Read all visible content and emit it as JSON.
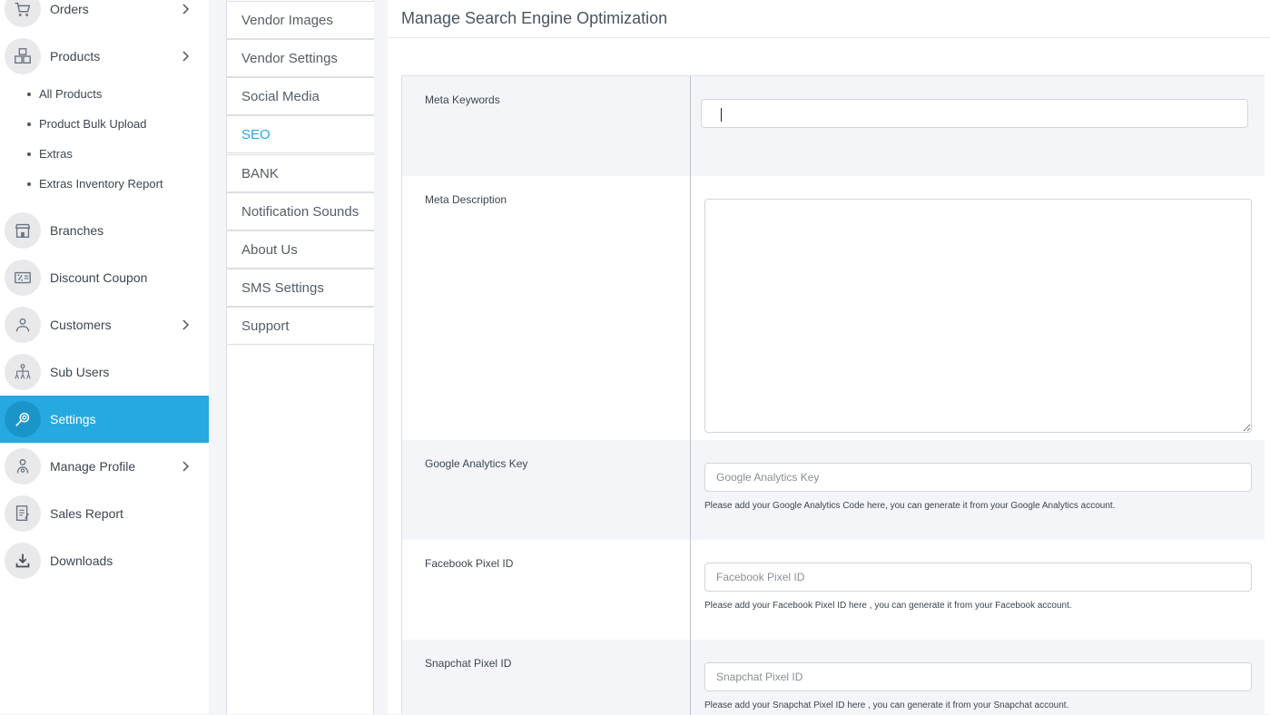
{
  "sidebar": {
    "items": [
      {
        "label": "Orders",
        "icon": "cart-icon"
      },
      {
        "label": "Products",
        "icon": "boxes-icon"
      },
      {
        "label": "Branches",
        "icon": "store-icon"
      },
      {
        "label": "Discount Coupon",
        "icon": "coupon-icon"
      },
      {
        "label": "Customers",
        "icon": "customers-icon"
      },
      {
        "label": "Sub Users",
        "icon": "hierarchy-icon"
      },
      {
        "label": "Settings",
        "icon": "settings-icon"
      },
      {
        "label": "Manage Profile",
        "icon": "profile-icon"
      },
      {
        "label": "Sales Report",
        "icon": "report-icon"
      },
      {
        "label": "Downloads",
        "icon": "download-icon"
      }
    ],
    "active": "Settings",
    "products_sub": [
      "All Products",
      "Product Bulk Upload",
      "Extras",
      "Extras Inventory Report"
    ]
  },
  "tabs": {
    "items": [
      "Vendor Images",
      "Vendor Settings",
      "Social Media",
      "SEO",
      "BANK",
      "Notification Sounds",
      "About Us",
      "SMS Settings",
      "Support"
    ],
    "active": "SEO",
    "active_color": "#26a9e0"
  },
  "main": {
    "title": "Manage Search Engine Optimization",
    "fields": {
      "meta_keywords": {
        "label": "Meta Keywords",
        "value": ""
      },
      "meta_description": {
        "label": "Meta Description",
        "value": ""
      },
      "google_analytics": {
        "label": "Google Analytics Key",
        "placeholder": "Google Analytics Key",
        "help": "Please add your Google Analytics Code here, you can generate it from your Google Analytics account."
      },
      "facebook_pixel": {
        "label": "Facebook Pixel ID",
        "placeholder": "Facebook Pixel ID",
        "help": "Please add your Facebook Pixel ID here , you can generate it from your Facebook account."
      },
      "snapchat_pixel": {
        "label": "Snapchat Pixel ID",
        "placeholder": "Snapchat Pixel ID",
        "help": "Please add your Snapchat Pixel ID here , you can generate it from your Snapchat account."
      }
    }
  },
  "colors": {
    "accent": "#26a9e0",
    "sidebar_bg": "#ffffff",
    "page_bg": "#f4f5f8"
  }
}
